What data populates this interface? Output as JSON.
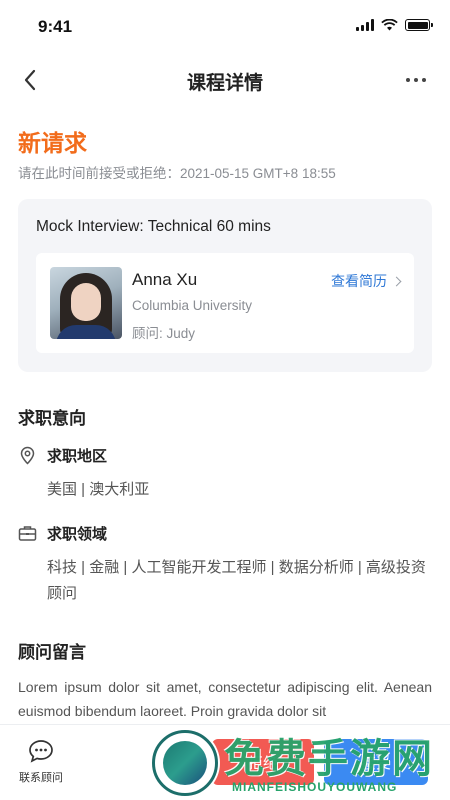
{
  "status_bar": {
    "time": "9:41"
  },
  "nav": {
    "title": "课程详情"
  },
  "request": {
    "status": "新请求",
    "deadline": "请在此时间前接受或拒绝：2021-05-15 GMT+8 18:55"
  },
  "course": {
    "title": "Mock Interview: Technical 60 mins",
    "student": {
      "name": "Anna Xu",
      "school": "Columbia University",
      "advisor": "顾问: Judy"
    },
    "resume_link": "查看简历"
  },
  "job_intent": {
    "section_title": "求职意向",
    "location": {
      "label": "求职地区",
      "value": "美国 | 澳大利亚",
      "icon": "location-pin-icon"
    },
    "field": {
      "label": "求职领域",
      "value": "科技 | 金融 | 人工智能开发工程师 | 数据分析师 | 高级投资顾问",
      "icon": "briefcase-icon"
    }
  },
  "advisor_message": {
    "section_title": "顾问留言",
    "text": "Lorem ipsum dolor sit amet, consectetur adipiscing elit. Aenean euismod bibendum laoreet. Proin gravida dolor sit"
  },
  "bottom_bar": {
    "contact_label": "联系顾问",
    "reject_label": "拒绝",
    "accept_label": "接受"
  },
  "watermark": {
    "text": "免费手游网",
    "pinyin": "MIANFEISHOUYOUWANG"
  },
  "colors": {
    "accent_orange": "#f26c1b",
    "link_blue": "#2f78d6",
    "reject_red": "#f25a53",
    "accept_blue": "#3b8af2"
  }
}
